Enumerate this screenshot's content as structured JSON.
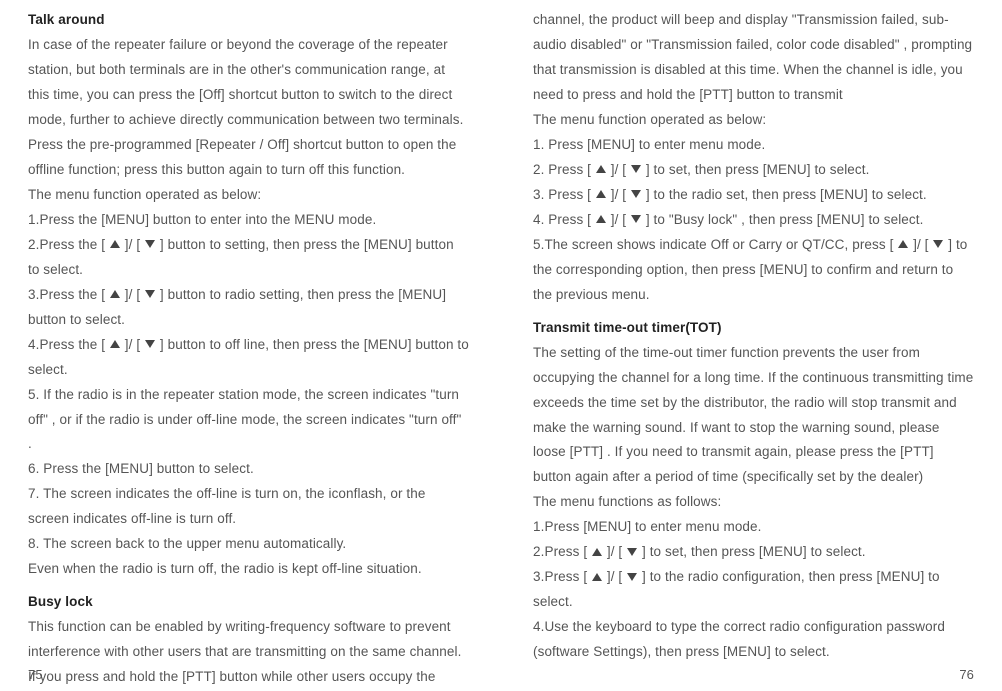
{
  "left": {
    "h1": "Talk around",
    "p1": "In case of the repeater failure or beyond the coverage of the repeater station, but both terminals are in the other's communication range, at this time, you can press the [Off] shortcut button to switch to the direct mode, further to achieve directly communication between  two terminals.",
    "p2": "Press the pre-programmed [Repeater / Off] shortcut button to open the offline function; press this button again to turn off this function.",
    "p3": "The menu function operated as below:",
    "s1": "1.Press the [MENU] button to enter into the MENU mode.",
    "s2a": "2.Press the [ ",
    "s2b": " ]/ [ ",
    "s2c": " ] button to setting, then press the [MENU] button to select.",
    "s3a": "3.Press the [ ",
    "s3b": " ]/ [ ",
    "s3c": " ] button to radio setting, then press the [MENU] button to select.",
    "s4a": "4.Press the [ ",
    "s4b": " ]/ [ ",
    "s4c": " ] button to off line, then press the [MENU] button to select.",
    "s5": "5. If the radio is in the repeater station mode, the screen indicates \"turn off\"  , or if the radio is under off-line mode, the screen indicates \"turn off\"  .",
    "s6": "6. Press the [MENU] button to select.",
    "s7": "7. The screen indicates the off-line is turn on, the iconflash, or the screen indicates off-line is turn off.",
    "s8": "8. The screen back to the upper menu automatically.",
    "p4": "Even when the radio is turn off, the radio is kept off-line situation.",
    "h2": "Busy lock",
    "bp1": "This function can be enabled by writing-frequency software to prevent interference with other users that are transmitting on the same channel.",
    "bp2": "If you press and hold the [PTT] button while other users occupy the",
    "page": "75"
  },
  "right": {
    "p1": "channel, the product will beep and display \"Transmission failed, sub-audio disabled\" or \"Transmission failed, color code disabled\"  , prompting that transmission is disabled at this time. When the channel is idle, you need to press and hold the [PTT] button to transmit",
    "p2": "The menu function operated as below:",
    "s1": "1. Press [MENU] to enter menu mode.",
    "s2a": "2. Press [ ",
    "s2b": " ]/ [ ",
    "s2c": " ] to set, then press [MENU] to select.",
    "s3a": "3. Press [ ",
    "s3b": " ]/ [ ",
    "s3c": " ] to the radio set, then press [MENU] to select.",
    "s4a": "4. Press [ ",
    "s4b": " ]/ [ ",
    "s4c": " ] to \"Busy lock\"  , then press [MENU] to select.",
    "s5a": "5.The screen shows indicate Off or Carry or QT/CC, press [ ",
    "s5b": " ]/ [ ",
    "s5c": " ] to the corresponding option, then press [MENU] to confirm and return to the previous menu.",
    "h2": "Transmit time-out timer(TOT)",
    "tp1": "The setting of the time-out timer function prevents the user from occupying the channel for a long time. If the continuous transmitting time exceeds the time set by the distributor, the radio will stop transmit and make the warning sound. If want to stop the warning sound, please loose [PTT] . If you need to transmit again, please press the [PTT] button again after a period of time (specifically set by the dealer)",
    "tp2": "The menu functions as follows:",
    "ts1": "1.Press [MENU] to enter menu mode.",
    "ts2a": "2.Press [ ",
    "ts2b": " ]/ [ ",
    "ts2c": " ] to set, then press [MENU] to select.",
    "ts3a": "3.Press [ ",
    "ts3b": " ]/ [ ",
    "ts3c": " ] to the radio configuration, then press [MENU] to select.",
    "ts4": "4.Use the keyboard to type the correct radio configuration password (software Settings), then press [MENU] to select.",
    "page": "76"
  }
}
